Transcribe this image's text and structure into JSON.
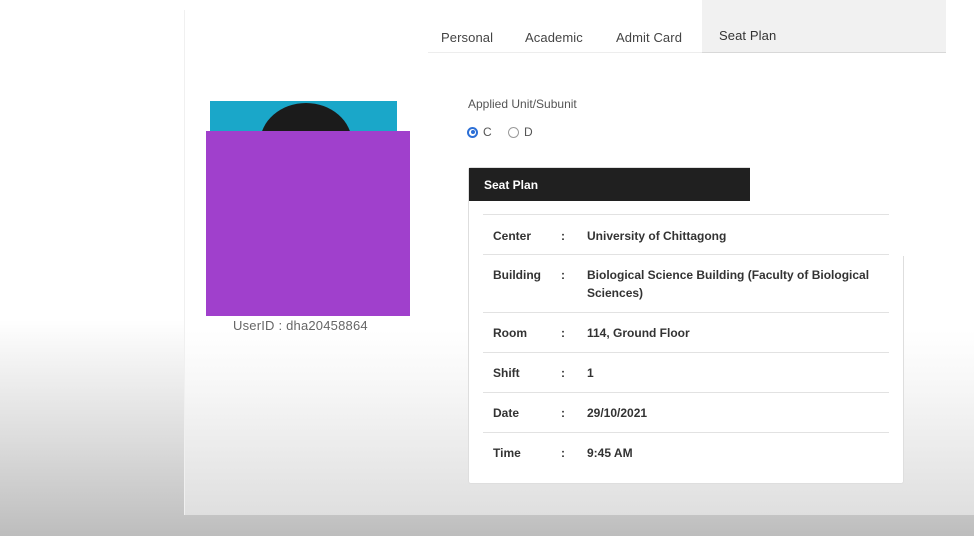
{
  "tabs": [
    {
      "label": "Personal"
    },
    {
      "label": "Academic"
    },
    {
      "label": "Admit Card"
    },
    {
      "label": "Seat Plan"
    }
  ],
  "profile": {
    "userid": "UserID : dha20458864"
  },
  "applied": {
    "label": "Applied Unit/Subunit",
    "options": [
      {
        "label": "C",
        "selected": true
      },
      {
        "label": "D",
        "selected": false
      }
    ]
  },
  "seat_plan": {
    "title": "Seat Plan",
    "separator": ":",
    "rows": [
      {
        "label": "Center",
        "value": "University of Chittagong"
      },
      {
        "label": "Building",
        "value": "Biological Science Building (Faculty of Biological Sciences)"
      },
      {
        "label": "Room",
        "value": "114, Ground Floor"
      },
      {
        "label": "Shift",
        "value": "1"
      },
      {
        "label": "Date",
        "value": "29/10/2021"
      },
      {
        "label": "Time",
        "value": "9:45 AM"
      }
    ]
  },
  "colors": {
    "redaction": "#a040cc",
    "radio_selected": "#2c6fd6",
    "header_bg": "#202020"
  }
}
